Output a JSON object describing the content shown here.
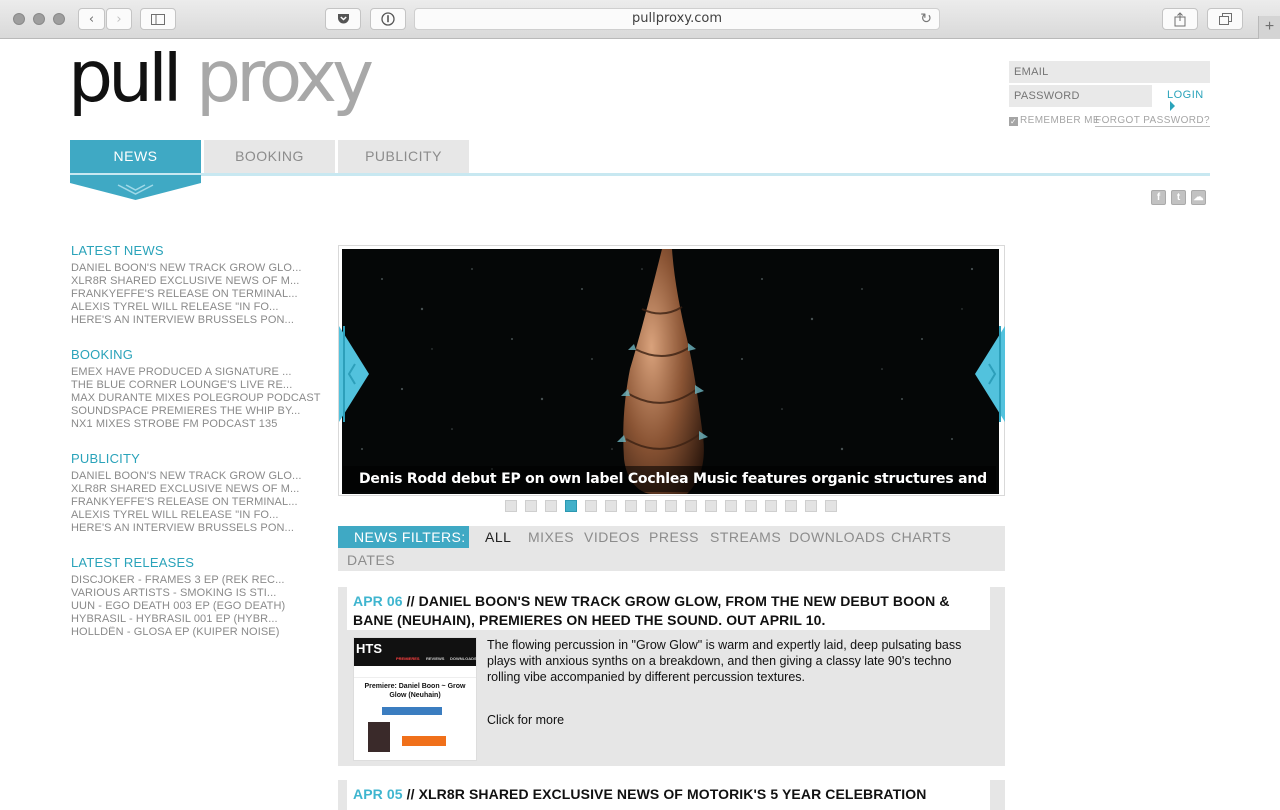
{
  "browser": {
    "url": "pullproxy.com",
    "icons": {
      "back": "chevron-left-icon",
      "forward": "chevron-right-icon",
      "sidebar": "sidebar-icon",
      "pocket": "pocket-icon",
      "privacy": "info-icon",
      "reload": "reload-icon",
      "share": "share-icon",
      "tabs": "tabs-icon",
      "new_tab": "plus-icon"
    }
  },
  "logo": {
    "part1": "pull",
    "part2": "proxy",
    "color1": "#111111",
    "color2": "#a8a8a8"
  },
  "login": {
    "email_placeholder": "EMAIL",
    "password_placeholder": "PASSWORD",
    "login_label": "LOGIN",
    "remember_label": "REMEMBER ME",
    "forgot_label": "FORGOT PASSWORD?"
  },
  "nav": {
    "tabs": [
      {
        "label": "NEWS",
        "active": true
      },
      {
        "label": "BOOKING",
        "active": false
      },
      {
        "label": "PUBLICITY",
        "active": false
      }
    ]
  },
  "social": [
    {
      "icon": "facebook-icon",
      "glyph": "f"
    },
    {
      "icon": "twitter-icon",
      "glyph": "t"
    },
    {
      "icon": "soundcloud-icon",
      "glyph": "☁"
    }
  ],
  "sidebar": {
    "sections": [
      {
        "title": "LATEST NEWS",
        "items": [
          "DANIEL BOON'S NEW TRACK GROW GLO...",
          "XLR8R SHARED EXCLUSIVE NEWS OF M...",
          "FRANKYEFFE'S RELEASE ON TERMINAL...",
          "ALEXIS TYREL WILL RELEASE \"IN FO...",
          "HERE'S AN INTERVIEW BRUSSELS PON..."
        ]
      },
      {
        "title": "BOOKING",
        "items": [
          "EMEX HAVE PRODUCED A SIGNATURE ...",
          "THE BLUE CORNER LOUNGE'S LIVE RE...",
          "MAX DURANTE MIXES POLEGROUP PODCAST",
          "SOUNDSPACE PREMIERES THE WHIP BY...",
          "NX1 MIXES STROBE FM PODCAST 135"
        ]
      },
      {
        "title": "PUBLICITY",
        "items": [
          "DANIEL BOON'S NEW TRACK GROW GLO...",
          "XLR8R SHARED EXCLUSIVE NEWS OF M...",
          "FRANKYEFFE'S RELEASE ON TERMINAL...",
          "ALEXIS TYREL WILL RELEASE \"IN FO...",
          "HERE'S AN INTERVIEW BRUSSELS PON..."
        ]
      },
      {
        "title": "LATEST RELEASES",
        "items": [
          "DISCJOKER - FRAMES 3 EP (REK REC...",
          "VARIOUS ARTISTS - SMOKING IS STI...",
          "UUN - EGO DEATH 003 EP (EGO DEATH)",
          "HYBRASIL - HYBRASIL 001 EP (HYBR...",
          "HOLLDËN - GLOSA EP (KUIPER NOISE)"
        ]
      }
    ]
  },
  "slider": {
    "caption": "Denis Rodd debut EP on own label Cochlea Music features organic structures and mumbled basslines",
    "dots_total": 17,
    "active_dot": 4,
    "icons": {
      "prev": "chevron-left-icon",
      "next": "chevron-right-icon"
    }
  },
  "filters": {
    "label": "NEWS FILTERS:",
    "items": [
      "ALL",
      "MIXES",
      "VIDEOS",
      "PRESS",
      "STREAMS",
      "DOWNLOADS",
      "CHARTS",
      "DATES"
    ],
    "selected": "ALL"
  },
  "articles": [
    {
      "date": "APR 06",
      "sep": " // ",
      "title": "DANIEL BOON'S NEW TRACK GROW GLOW, FROM THE NEW DEBUT BOON & BANE (NEUHAIN), PREMIERES ON HEED THE SOUND. OUT APRIL 10.",
      "body": "The flowing percussion in \"Grow Glow\" is warm and expertly laid, deep pulsating bass plays with anxious synths on a breakdown, and then giving a classy late 90's techno rolling vibe accompanied by different percussion textures.",
      "more": "Click for more",
      "thumb": {
        "brand": "HTS",
        "menu": [
          "PREMIERES",
          "REVIEWS",
          "DOWNLOADS"
        ],
        "headline": "Premiere: Daniel Boon ~ Grow Glow (Neuhain)"
      }
    },
    {
      "date": "APR 05",
      "sep": " // ",
      "title": "XLR8R SHARED EXCLUSIVE NEWS OF MOTORIK'S 5 YEAR CELEBRATION"
    }
  ],
  "colors": {
    "accent": "#3fa9c4",
    "link": "#2aa3ba",
    "panel": "#e6e6e6"
  }
}
